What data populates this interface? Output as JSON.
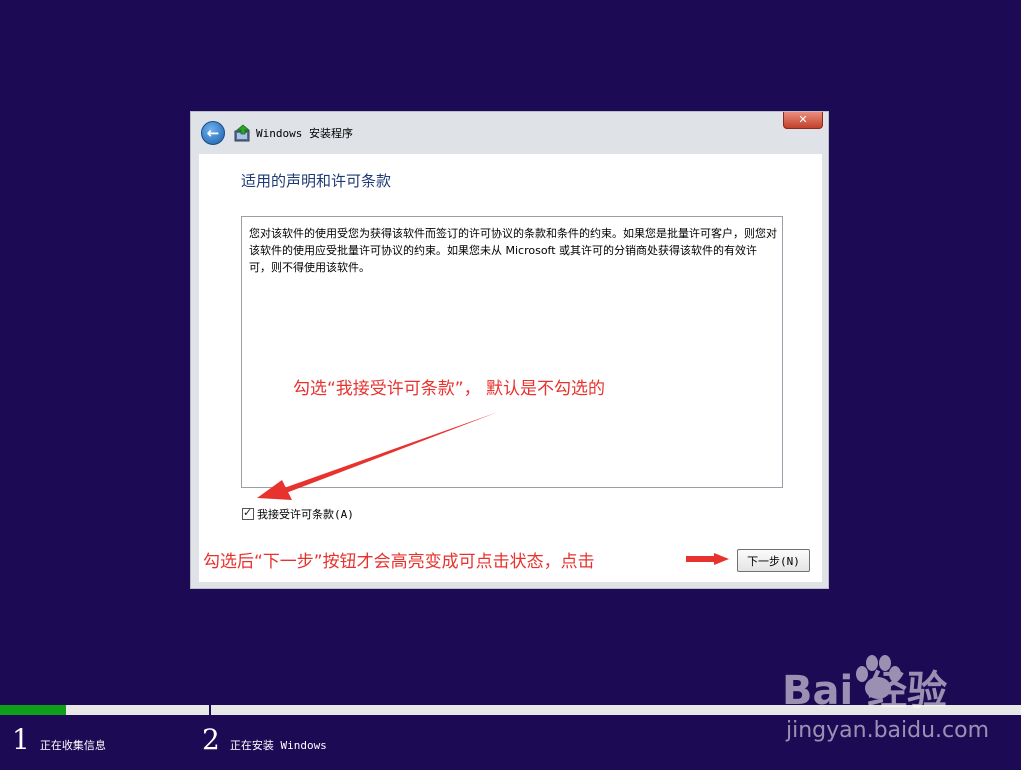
{
  "window": {
    "title": "Windows 安装程序",
    "close_label": "✕"
  },
  "page": {
    "title": "适用的声明和许可条款"
  },
  "license": {
    "text": "您对该软件的使用受您为获得该软件而签订的许可协议的条款和条件的约束。如果您是批量许可客户，则您对该软件的使用应受批量许可协议的约束。如果您未从 Microsoft 或其许可的分销商处获得该软件的有效许可，则不得使用该软件。"
  },
  "accept": {
    "label": "我接受许可条款(A)",
    "checked": true
  },
  "buttons": {
    "next_label": "下一步(N)"
  },
  "annotations": {
    "check_hint": "勾选“我接受许可条款”， 默认是不勾选的",
    "next_hint": "勾选后“下一步”按钮才会高亮变成可点击状态，点击"
  },
  "progress": {
    "fraction": 0.065,
    "steps": [
      {
        "num": "1",
        "label": "正在收集信息"
      },
      {
        "num": "2",
        "label": "正在安装 Windows"
      }
    ]
  },
  "watermark": {
    "logo": "Bai  经验",
    "url": "jingyan.baidu.com"
  },
  "colors": {
    "background": "#1c0a55",
    "annotation": "#e8322e",
    "progress": "#0ea01a"
  }
}
